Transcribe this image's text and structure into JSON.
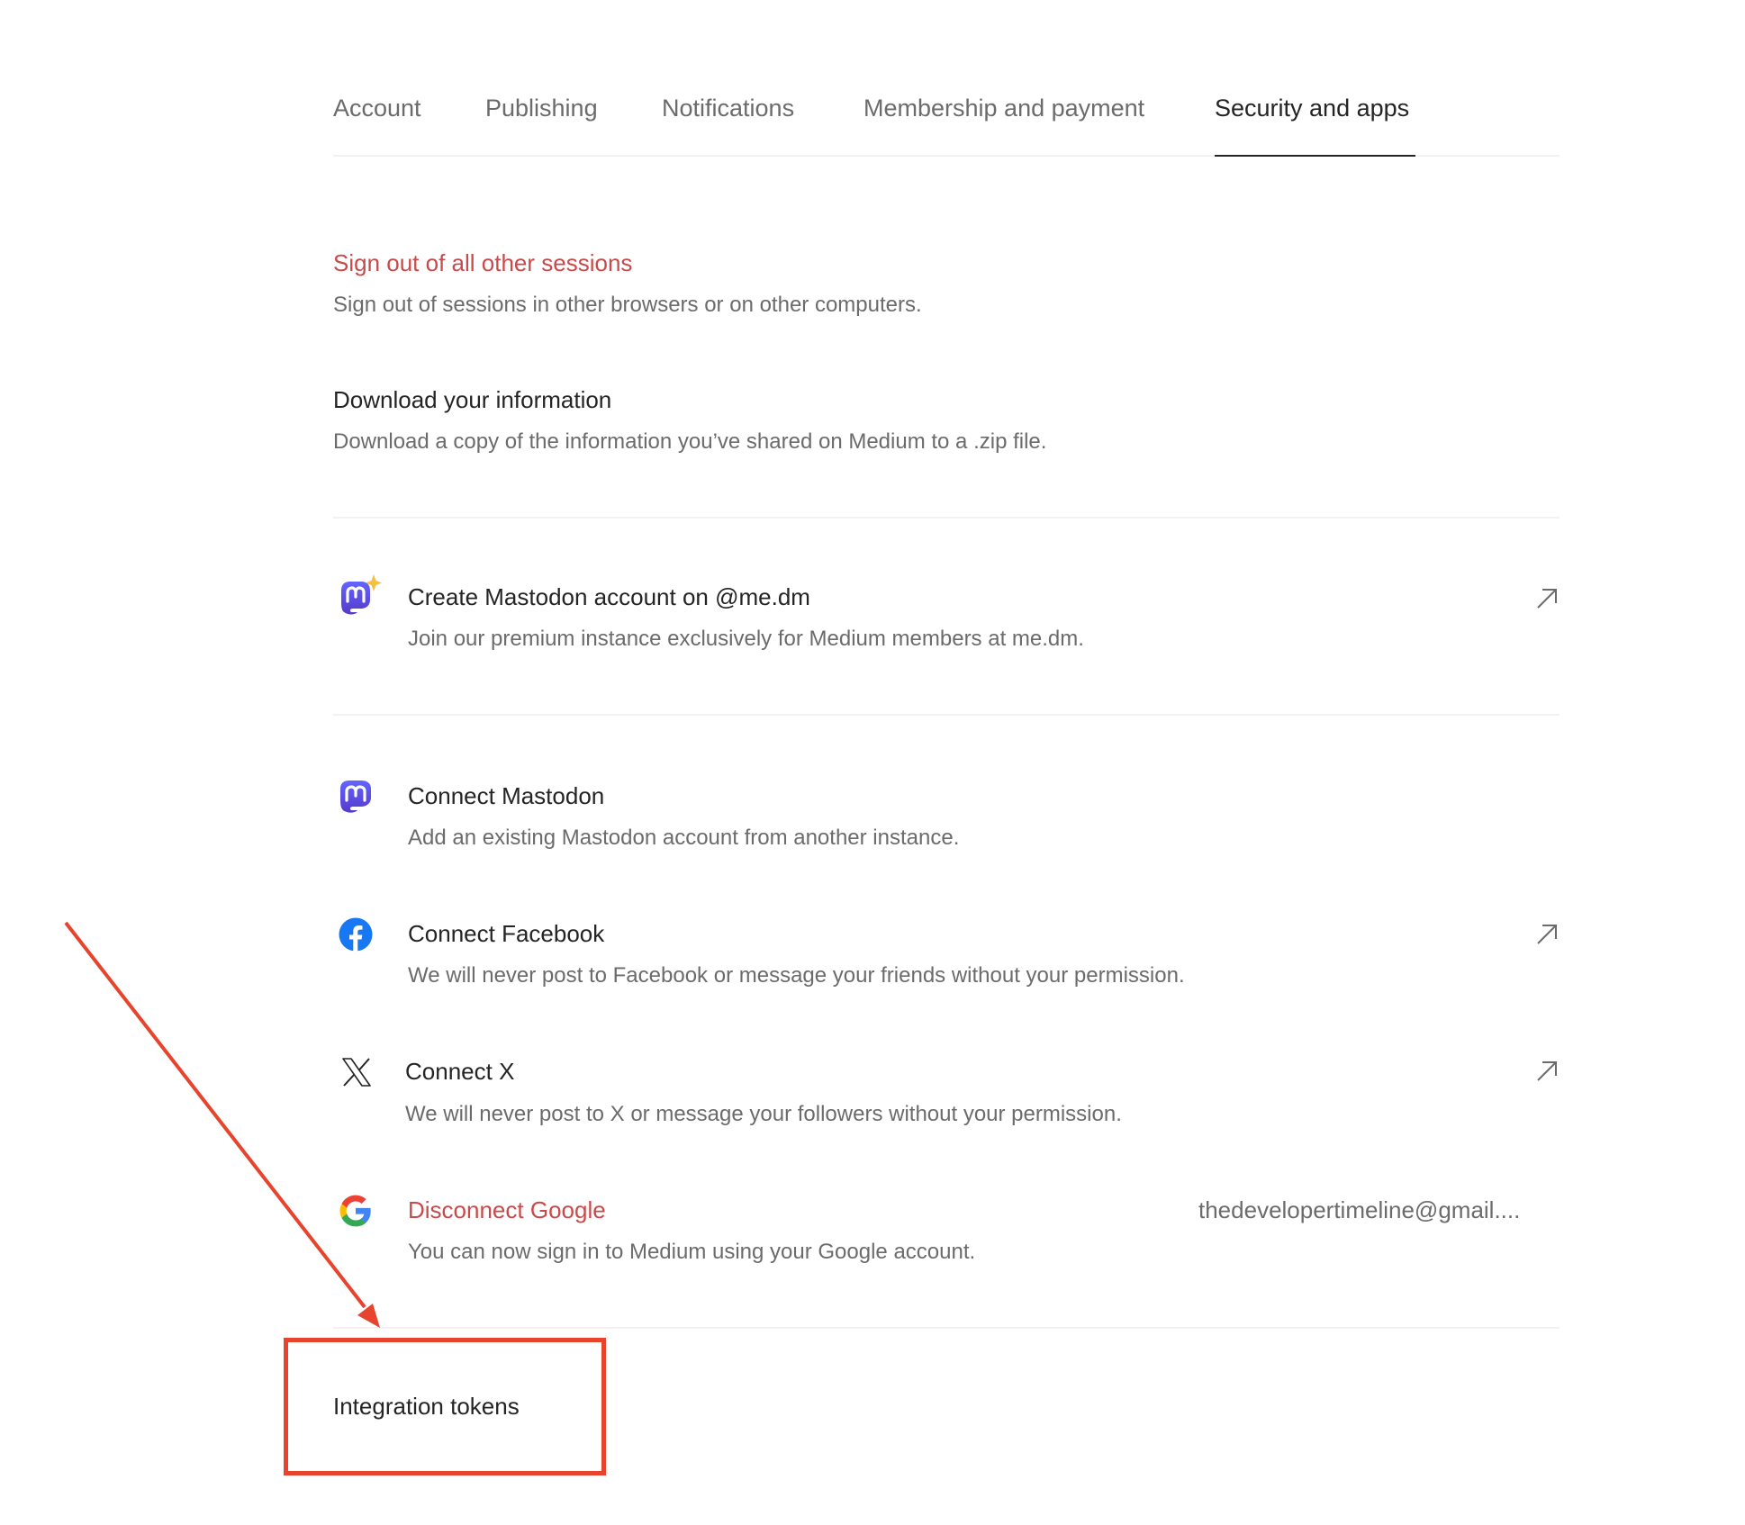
{
  "tabs": [
    {
      "label": "Account",
      "active": false
    },
    {
      "label": "Publishing",
      "active": false
    },
    {
      "label": "Notifications",
      "active": false
    },
    {
      "label": "Membership and payment",
      "active": false
    },
    {
      "label": "Security and apps",
      "active": true
    }
  ],
  "security": {
    "sign_out": {
      "title": "Sign out of all other sessions",
      "description": "Sign out of sessions in other browsers or on other computers."
    },
    "download": {
      "title": "Download your information",
      "description": "Download a copy of the information you’ve shared on Medium to a .zip file."
    }
  },
  "apps": {
    "create_mastodon": {
      "icon": "mastodon-sparkle-icon",
      "title": "Create Mastodon account on @me.dm",
      "description": "Join our premium instance exclusively for Medium members at me.dm.",
      "action_icon": "external-link-arrow-icon"
    },
    "connect_mastodon": {
      "icon": "mastodon-icon",
      "title": "Connect Mastodon",
      "description": "Add an existing Mastodon account from another instance."
    },
    "connect_facebook": {
      "icon": "facebook-icon",
      "title": "Connect Facebook",
      "description": "We will never post to Facebook or message your friends without your permission.",
      "action_icon": "external-link-arrow-icon"
    },
    "connect_x": {
      "icon": "x-icon",
      "title": "Connect X",
      "description": "We will never post to X or message your followers without your permission.",
      "action_icon": "external-link-arrow-icon"
    },
    "disconnect_google": {
      "icon": "google-icon",
      "title": "Disconnect Google",
      "description": "You can now sign in to Medium using your Google account.",
      "account_email": "thedevelopertimeline@gmail...."
    }
  },
  "integration_tokens": {
    "title": "Integration tokens"
  },
  "colors": {
    "danger": "#c94a4a",
    "annotation": "#e8432c",
    "mastodon": "#6364ff",
    "facebook": "#1877f2"
  },
  "annotation": {
    "type": "arrow-and-box",
    "target": "integration-tokens"
  }
}
